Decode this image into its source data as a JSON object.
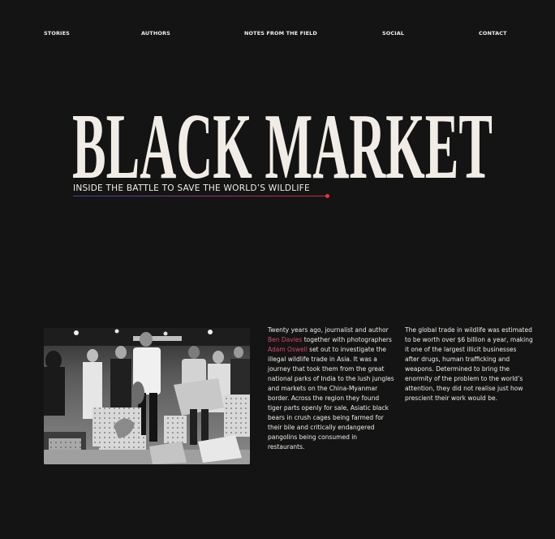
{
  "nav": {
    "items": [
      {
        "label": "STORIES"
      },
      {
        "label": "AUTHORS"
      },
      {
        "label": "NOTES FROM THE FIELD"
      },
      {
        "label": "SOCIAL"
      },
      {
        "label": "CONTACT"
      }
    ]
  },
  "hero": {
    "title": "BLACK MARKET",
    "subtitle": "INSIDE THE BATTLE TO SAVE THE WORLD’S WILDLIFE",
    "accent_gradient": [
      "#4a3fa8",
      "#8a3a86",
      "#cc2a34"
    ],
    "dot_color": "#e2353d"
  },
  "photo": {
    "description": "Black and white photograph of men inspecting crates and boxes at a night market"
  },
  "intro": {
    "l1": "Twenty years ago, journalist and author",
    "author_name": "Ben Davies",
    "l2_rest": " together with photographers",
    "photographer_name": "Adam Oswell",
    "l3_rest": " set out to investigate the",
    "l4": "illegal wildlife trade in Asia. It was a",
    "l5": "journey that took them from the great",
    "l6": "national parks of India to the lush jungles",
    "l7": "and markets on the China-Myanmar",
    "l8": "border. Across the region they found",
    "l9": "tiger parts openly for sale, Asiatic black",
    "l10": "bears in crush cages being farmed for",
    "l11": "their bile and critically endangered",
    "l12": "pangolins being consumed in",
    "l13": "restaurants."
  },
  "context": {
    "l1": "The global trade in wildlife was estimated",
    "l2": "to be worth over $6 billion a year, making",
    "l3": "it one of the largest illicit businesses",
    "l4": "after drugs, human trafficking and",
    "l5": "weapons. Determined to bring the",
    "l6": "enormity of the problem to the world’s",
    "l7": "attention, they did not realise just how",
    "l8": "prescient their work would be."
  },
  "colors": {
    "background": "#141414",
    "text": "#f1ede6",
    "link": "#d9476f"
  }
}
